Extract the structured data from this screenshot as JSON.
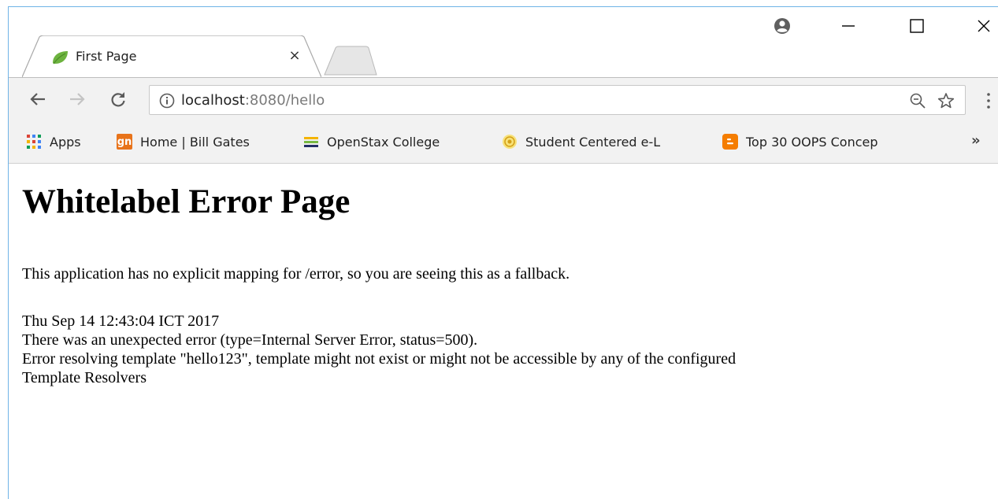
{
  "tab": {
    "title": "First Page",
    "close_glyph": "×"
  },
  "window_controls": {
    "profile_icon": "profile-icon",
    "minimize_icon": "minimize-icon",
    "maximize_icon": "maximize-icon",
    "close_icon": "close-icon"
  },
  "toolbar": {
    "url_host": "localhost",
    "url_rest": ":8080/hello",
    "icons": [
      "back-arrow-icon",
      "forward-arrow-icon",
      "reload-icon",
      "info-icon",
      "zoom-icon",
      "star-icon"
    ]
  },
  "bookmarks": {
    "items": [
      {
        "label": "Apps",
        "icon": "apps-grid-icon"
      },
      {
        "label": "Home | Bill Gates",
        "icon": "gn-icon",
        "icon_text": "gn"
      },
      {
        "label": "OpenStax College",
        "icon": "openstax-icon"
      },
      {
        "label": "Student Centered e-L",
        "icon": "student-centered-icon"
      },
      {
        "label": "Top 30 OOPS Concep",
        "icon": "blogger-icon"
      }
    ],
    "more": "»"
  },
  "page": {
    "heading": "Whitelabel Error Page",
    "paragraph1": "This application has no explicit mapping for /error, so you are seeing this as a fallback.",
    "timestamp": "Thu Sep 14 12:43:04 ICT 2017",
    "error_line": "There was an unexpected error (type=Internal Server Error, status=500).",
    "detail_line1": "Error resolving template \"hello123\", template might not exist or might not be accessible by any of the configured",
    "detail_line2": "Template Resolvers"
  },
  "colors": {
    "spring_green": "#6db33f",
    "gn_orange": "#e8731a",
    "blogger_orange": "#f57d00",
    "window_border": "#6fb3e6"
  }
}
